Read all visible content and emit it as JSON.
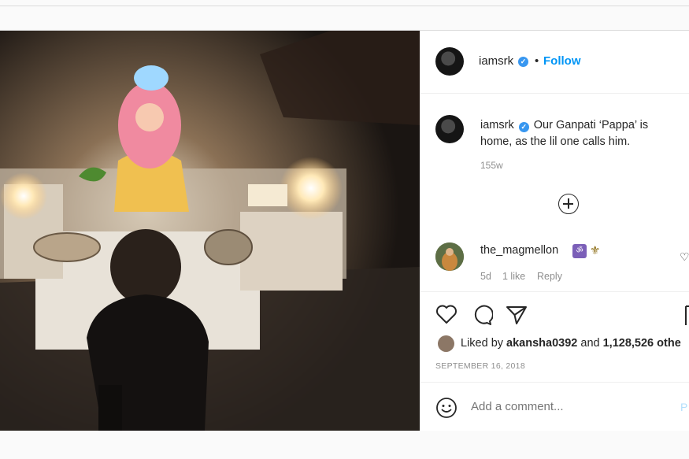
{
  "post": {
    "username": "iamsrk",
    "dot": "•",
    "follow_label": "Follow",
    "verified_mark": "✓",
    "caption_text": "Our Ganpati ‘Pappa’ is home, as the lil one calls him.",
    "caption_age": "155w",
    "comment": {
      "username": "the_magmellon",
      "age": "5d",
      "likes": "1 like",
      "reply_label": "Reply",
      "emoji_1": "ॐ",
      "emoji_2": "⚜"
    },
    "liked_by_prefix": "Liked by",
    "liked_by_user": "akansha0392",
    "liked_by_suffix": "and",
    "liked_by_count": "1,128,526 othe",
    "date": "SEPTEMBER 16, 2018",
    "add_comment_placeholder": "Add a comment...",
    "post_label": "P"
  },
  "icons": {
    "heart": "heart-icon",
    "comment": "comment-icon",
    "share": "share-icon",
    "bookmark": "bookmark-icon",
    "load_more": "plus-circle-icon",
    "emoji": "smiley-icon"
  },
  "colors": {
    "link_blue": "#0095f6",
    "verified_blue": "#3897f0",
    "muted_text": "#8e8e8e",
    "post_disabled": "#b2dffc"
  }
}
